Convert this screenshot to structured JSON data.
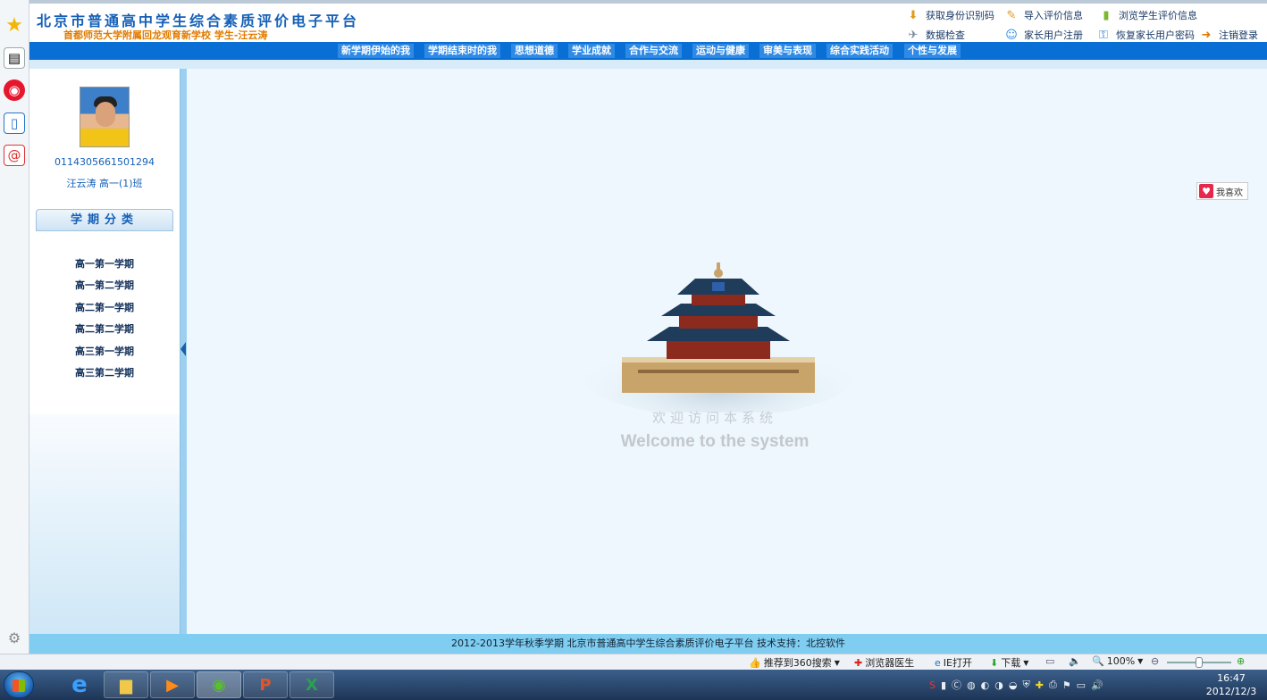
{
  "header": {
    "site_title": "北京市普通高中学生综合素质评价电子平台",
    "school_line": "首都师范大学附属回龙观育新学校  学生-汪云涛",
    "links": [
      {
        "label": "获取身份识别码",
        "icon": "download-person-icon"
      },
      {
        "label": "导入评价信息",
        "icon": "import-icon"
      },
      {
        "label": "浏览学生评价信息",
        "icon": "book-icon"
      },
      {
        "label": "数据检查",
        "icon": "data-check-icon"
      },
      {
        "label": "家长用户注册",
        "icon": "parent-register-icon"
      },
      {
        "label": "恢复家长用户密码",
        "icon": "restore-password-icon"
      },
      {
        "label": "注销登录",
        "icon": "logout-icon"
      }
    ]
  },
  "nav": {
    "items": [
      "新学期伊始的我",
      "学期结束时的我",
      "思想道德",
      "学业成就",
      "合作与交流",
      "运动与健康",
      "审美与表现",
      "综合实践活动",
      "个性与发展"
    ]
  },
  "student": {
    "id": "0114305661501294",
    "name_class": "汪云涛  高一(1)班"
  },
  "semesters": {
    "title": "学期分类",
    "items": [
      "高一第一学期",
      "高一第二学期",
      "高二第一学期",
      "高二第二学期",
      "高三第一学期",
      "高三第二学期"
    ]
  },
  "main": {
    "welcome_cn": "欢迎访问本系统",
    "welcome_en": "Welcome to the system",
    "like_label": "我喜欢"
  },
  "footer": {
    "text": "2012-2013学年秋季学期  北京市普通高中学生综合素质评价电子平台  技术支持：北控软件"
  },
  "statusbar": {
    "search_label": "推荐到360搜索",
    "doctor_label": "浏览器医生",
    "ie_label": "IE打开",
    "download_label": "下载",
    "zoom_label": "100%"
  },
  "taskbar": {
    "time": "16:47",
    "date": "2012/12/3"
  },
  "colors": {
    "brand_blue": "#0a6fd4",
    "title_blue": "#1560b8",
    "accent_orange": "#e07b00",
    "footer_blue": "#7fcdf0"
  }
}
